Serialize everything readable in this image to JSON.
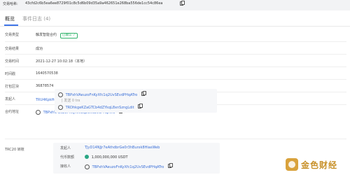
{
  "header": {
    "hash_label": "交易哈希:",
    "hash_value": "43cfd2c6b5ea6ee8729f01c8c5d6b09d35a9a462651e268ba556de1cc54c86ea"
  },
  "tabs": [
    {
      "label": "概览",
      "active": true
    },
    {
      "label": "事件日志 (4)",
      "active": false
    }
  ],
  "fields": {
    "tx_type": {
      "label": "交易类型",
      "value": "触发智能合约",
      "badge": "已确认 ✓"
    },
    "tx_result": {
      "label": "交易结果",
      "value": "成功"
    },
    "tx_time": {
      "label": "交易时间",
      "value": "2021-12-27 10:02:18（本地）"
    },
    "timestamp": {
      "label": "时间戳",
      "value": "1640570538"
    },
    "block": {
      "label": "打包区块",
      "value": "36878574"
    },
    "sender": {
      "label": "发起人",
      "value": "TRU4KpkHqdACrcxKzLrf2aNjwsWUQnwzjN"
    },
    "contract": {
      "label": "合约地址",
      "address": "TBPxhVAeuzoFnKyXfc1q2UvSEvdPHqATro",
      "inner_address": "TBPxhVAeuzoFnKyXfc1q2UvSEvdPHqATro",
      "inner_amount": "| 发送 0 trx",
      "inner_to": "TRDhkgeKZaGTCb4dZYkqL8xnSzngLdit"
    },
    "trc20": {
      "label": "TRC20 转账",
      "sender_label": "发起人",
      "sender_value": "TJyD14NJjr7eAthdbrGe0r3hBurxk8HiasWeb",
      "amount_label": "代币数额",
      "amount_value": "1,000,000,000 USDT",
      "receiver_label": "接收人",
      "receiver_value": "TBPxhVAeuzoFnKyXfc1q2UvSEvdPHqATro"
    }
  },
  "watermark": {
    "text": "金色财经"
  },
  "colors": {
    "accent": "#3a6fd8",
    "success": "#31b36b",
    "token": "#2aa684"
  }
}
